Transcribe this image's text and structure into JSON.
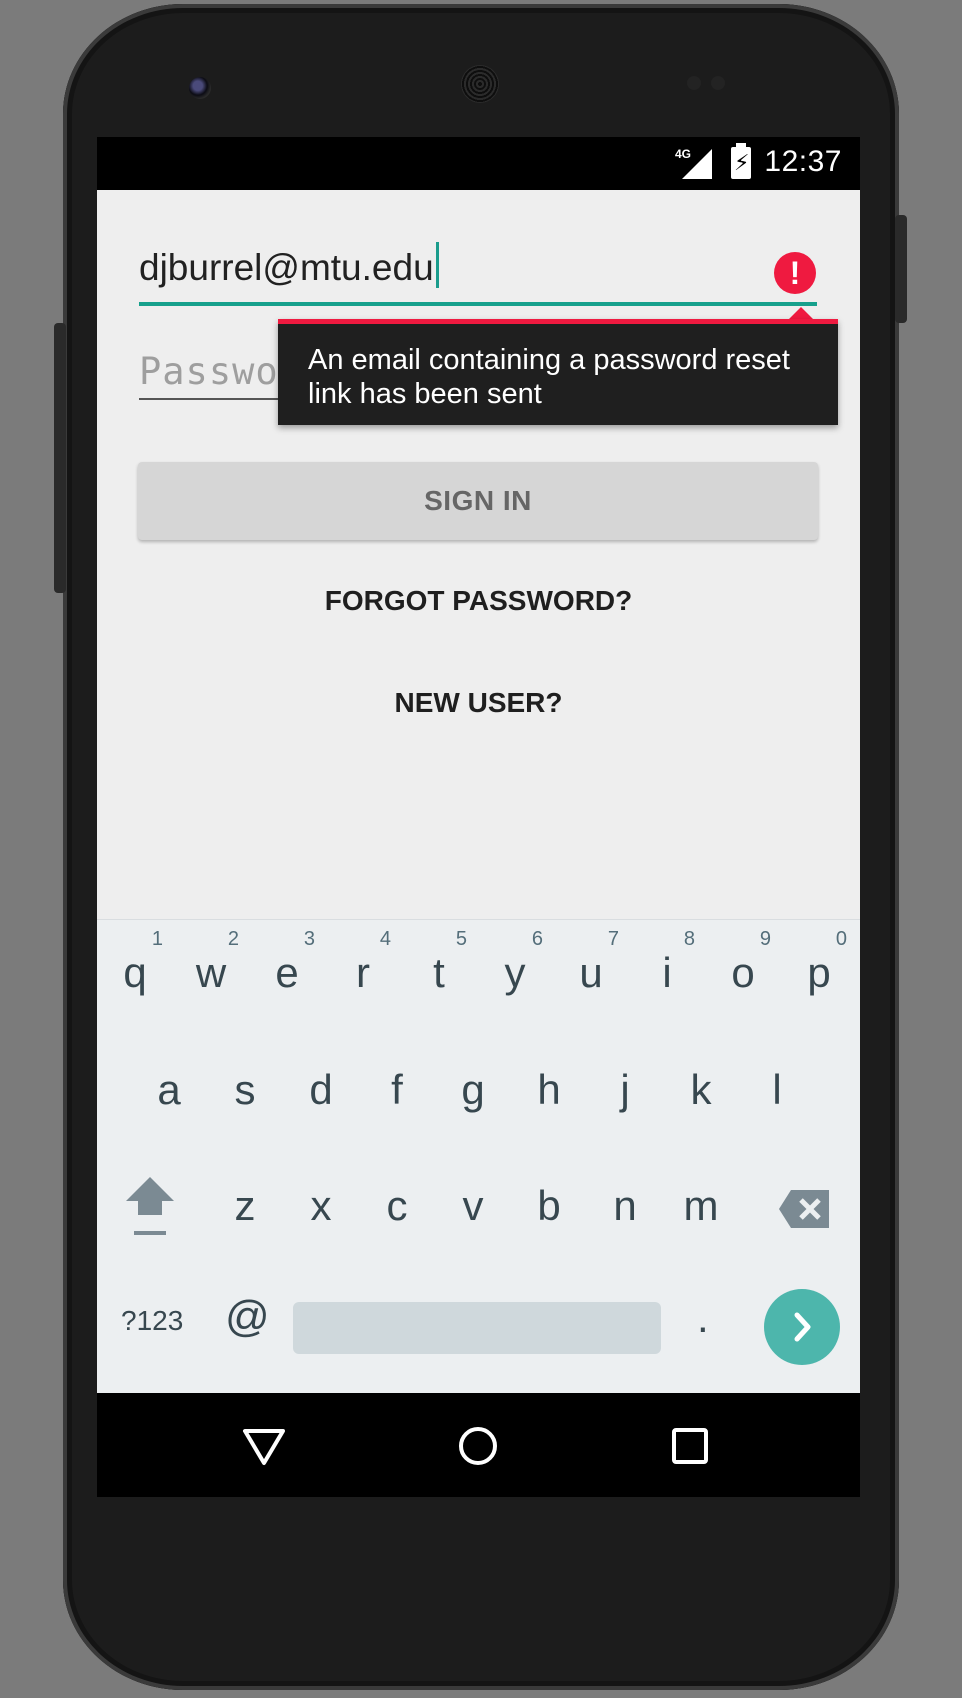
{
  "status_bar": {
    "network": "4G",
    "time": "12:37"
  },
  "login_form": {
    "email_value": "djburrel@mtu.edu",
    "password_placeholder": "Password",
    "error_popup_text": "An email containing a password reset link has been sent",
    "sign_in_label": "SIGN IN",
    "forgot_password_label": "FORGOT PASSWORD?",
    "new_user_label": "NEW USER?"
  },
  "keyboard": {
    "row1": [
      {
        "key": "q",
        "num": "1"
      },
      {
        "key": "w",
        "num": "2"
      },
      {
        "key": "e",
        "num": "3"
      },
      {
        "key": "r",
        "num": "4"
      },
      {
        "key": "t",
        "num": "5"
      },
      {
        "key": "y",
        "num": "6"
      },
      {
        "key": "u",
        "num": "7"
      },
      {
        "key": "i",
        "num": "8"
      },
      {
        "key": "o",
        "num": "9"
      },
      {
        "key": "p",
        "num": "0"
      }
    ],
    "row2": [
      "a",
      "s",
      "d",
      "f",
      "g",
      "h",
      "j",
      "k",
      "l"
    ],
    "row3": [
      "z",
      "x",
      "c",
      "v",
      "b",
      "n",
      "m"
    ],
    "symbols_label": "?123",
    "at_label": "@",
    "period_label": "."
  },
  "icons": {
    "error": "exclamation-icon",
    "shift": "shift-icon",
    "backspace": "backspace-icon",
    "go": "chevron-right-icon",
    "nav_back": "triangle-back-icon",
    "nav_home": "circle-home-icon",
    "nav_recents": "square-recents-icon"
  },
  "colors": {
    "accent": "#16a08c",
    "error": "#ef1a40",
    "go_button": "#4db6ac"
  }
}
